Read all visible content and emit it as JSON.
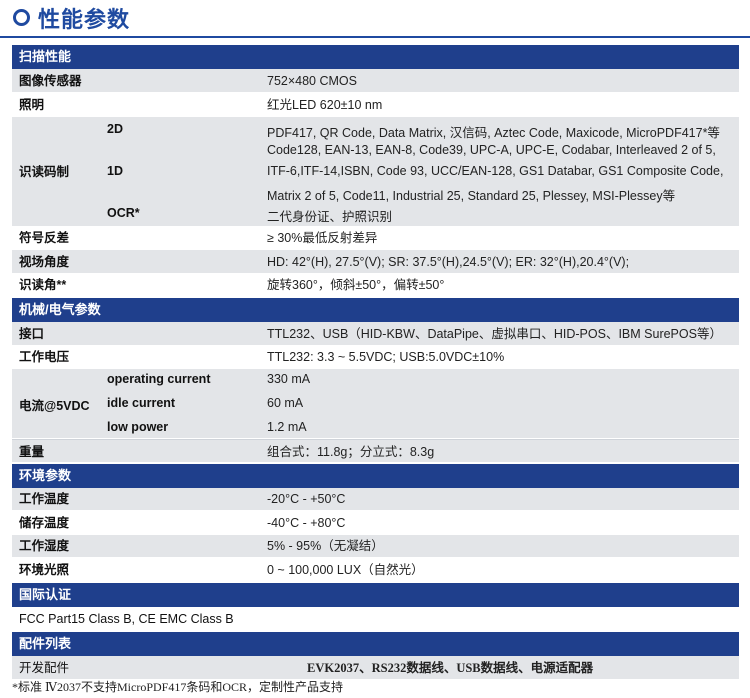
{
  "title": "性能参数",
  "sections": {
    "scan": "扫描性能",
    "mech": "机械/电气参数",
    "env": "环境参数",
    "cert": "国际认证",
    "acc": "配件列表"
  },
  "scan": {
    "sensor": {
      "label": "图像传感器",
      "value": "752×480 CMOS"
    },
    "illum": {
      "label": "照明",
      "value": "红光LED 620±10 nm"
    },
    "symb": {
      "label": "识读码制",
      "d2_label": "2D",
      "d2_value": "PDF417, QR Code, Data Matrix, 汉信码, Aztec Code, Maxicode, MicroPDF417*等",
      "d1_label": "1D",
      "d1_lines": [
        "Code128, EAN-13, EAN-8, Code39, UPC-A, UPC-E, Codabar, Interleaved 2 of 5,",
        "ITF-6,ITF-14,ISBN, Code 93, UCC/EAN-128, GS1 Databar, GS1 Composite Code,",
        "Matrix 2 of 5, Code11, Industrial 25, Standard 25, Plessey, MSI-Plessey等"
      ],
      "ocr_label": "OCR*",
      "ocr_value": "二代身份证、护照识别"
    },
    "contrast": {
      "label": "符号反差",
      "value": "≥ 30%最低反射差异"
    },
    "fov": {
      "label": "视场角度",
      "value": "HD: 42°(H), 27.5°(V);    SR: 37.5°(H),24.5°(V);    ER: 32°(H),20.4°(V);"
    },
    "angle": {
      "label": "识读角**",
      "value": "旋转360°，倾斜±50°，偏转±50°"
    }
  },
  "mech": {
    "iface": {
      "label": "接口",
      "value": "TTL232、USB（HID-KBW、DataPipe、虚拟串口、HID-POS、IBM SurePOS等）"
    },
    "voltage": {
      "label": "工作电压",
      "value": "TTL232: 3.3 ~ 5.5VDC; USB:5.0VDC±10%"
    },
    "current": {
      "label": "电流@5VDC",
      "op_label": "operating current",
      "op_value": "330 mA",
      "idle_label": "idle current",
      "idle_value": "60 mA",
      "low_label": "low power",
      "low_value": "1.2 mA"
    },
    "weight": {
      "label": "重量",
      "value": "组合式：11.8g；分立式：8.3g"
    }
  },
  "env": {
    "op_temp": {
      "label": "工作温度",
      "value": "-20°C - +50°C"
    },
    "st_temp": {
      "label": "储存温度",
      "value": "-40°C - +80°C"
    },
    "humid": {
      "label": "工作湿度",
      "value": "5% - 95%（无凝结）"
    },
    "light": {
      "label": "环境光照",
      "value": "0 ~ 100,000 LUX（自然光）"
    }
  },
  "cert": {
    "value": "FCC Part15 Class B, CE EMC Class B"
  },
  "acc": {
    "label": "开发配件",
    "value": "EVK2037、RS232数据线、USB数据线、电源适配器"
  },
  "note": "*标准 Ⅳ2037不支持MicroPDF417条码和OCR，定制性产品支持"
}
